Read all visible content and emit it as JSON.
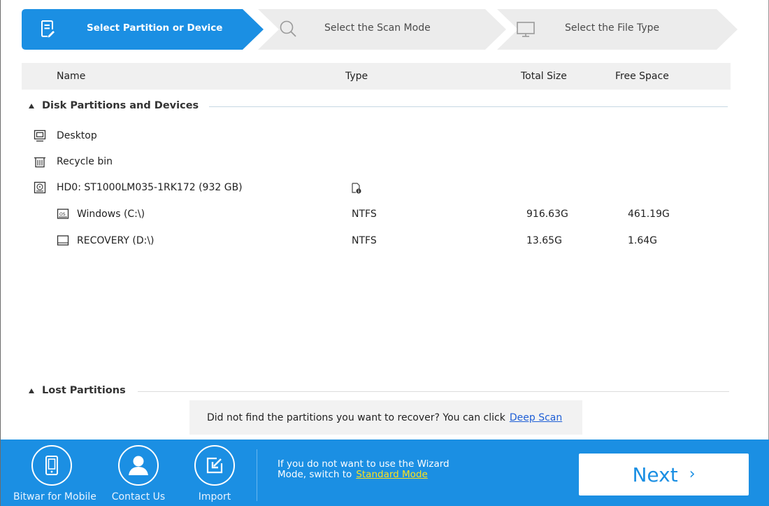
{
  "wizard": {
    "steps": [
      {
        "label": "Select Partition or Device",
        "active": true,
        "icon": "document-edit-icon"
      },
      {
        "label": "Select the Scan Mode",
        "active": false,
        "icon": "search-icon"
      },
      {
        "label": "Select the File Type",
        "active": false,
        "icon": "monitor-icon"
      }
    ]
  },
  "columns": {
    "name": "Name",
    "type": "Type",
    "total": "Total Size",
    "free": "Free Space"
  },
  "sections": {
    "disk": "Disk Partitions and Devices",
    "lost": "Lost Partitions"
  },
  "rows": [
    {
      "name": "Desktop",
      "icon": "desktop-icon",
      "type": "",
      "total": "",
      "free": ""
    },
    {
      "name": "Recycle bin",
      "icon": "recycle-bin-icon",
      "type": "",
      "total": "",
      "free": ""
    },
    {
      "name": "HD0: ST1000LM035-1RK172 (932 GB)",
      "icon": "hard-disk-icon",
      "type_icon": "disk-info-icon",
      "type": "",
      "total": "",
      "free": ""
    },
    {
      "name": "Windows (C:\\)",
      "icon": "os-drive-icon",
      "type": "NTFS",
      "total": "916.63G",
      "free": "461.19G"
    },
    {
      "name": "RECOVERY (D:\\)",
      "icon": "drive-icon",
      "type": "NTFS",
      "total": "13.65G",
      "free": "1.64G"
    }
  ],
  "notice": {
    "text": "Did not find the partitions you want to recover? You can click",
    "link": "Deep Scan"
  },
  "bottom": {
    "mobile": "Bitwar for Mobile",
    "contact": "Contact Us",
    "import": "Import",
    "wizard_line1": "If you do not want to use the Wizard",
    "wizard_line2": "Mode, switch to",
    "wizard_link": "Standard Mode",
    "next": "Next",
    "next_chevron": "›"
  },
  "colors": {
    "accent": "#1b8fe3",
    "step_inactive": "#ececec",
    "link": "#1f5fd6",
    "bottom_link": "#ffe21b"
  }
}
